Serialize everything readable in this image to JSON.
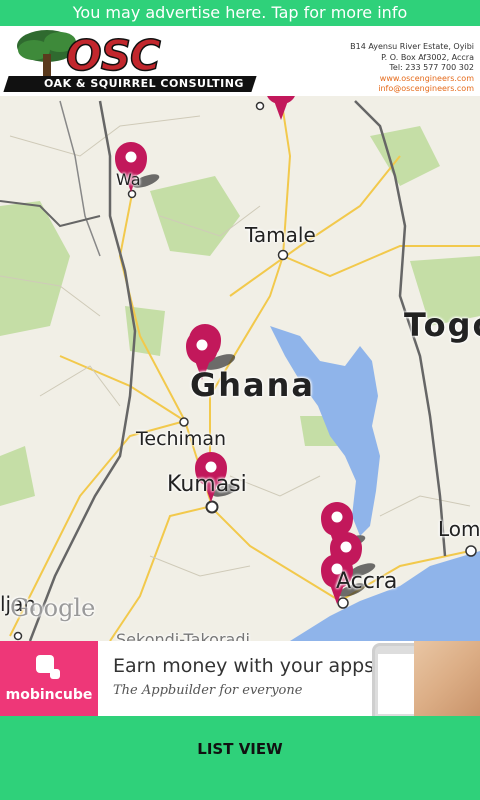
{
  "top_ad": {
    "text": "You may advertise here. Tap for more info"
  },
  "header": {
    "logo_text": "OSC",
    "logo_subtitle": "OAK & SQUIRREL CONSULTING",
    "address_lines": [
      "B14 Ayensu River Estate, Oyibi",
      "P. O. Box Af3002, Accra",
      "Tel: 233 577 700 302"
    ],
    "website": "www.oscengineers.com",
    "email": "info@oscengineers.com"
  },
  "map": {
    "labels": {
      "tamale": "Tamale",
      "togo": "Togo",
      "ghana": "Ghana",
      "techiman": "Techiman",
      "kumasi": "Kumasi",
      "wa": "Wa",
      "accra": "Accra",
      "lome": "Lom",
      "partial_left": "ljan",
      "partial_bottom": "Sekondi-Takoradi"
    },
    "attribution": "Google",
    "colors": {
      "land": "#f1efe6",
      "water": "#8fb4ea",
      "park": "#c5dea6",
      "road": "#f2c94c",
      "border": "#666666",
      "pin": "#c2185b"
    }
  },
  "banner": {
    "brand": "mobincube",
    "title": "Earn money with your apps",
    "subtitle": "The Appbuilder for everyone"
  },
  "footer": {
    "list_view_label": "LIST VIEW"
  }
}
